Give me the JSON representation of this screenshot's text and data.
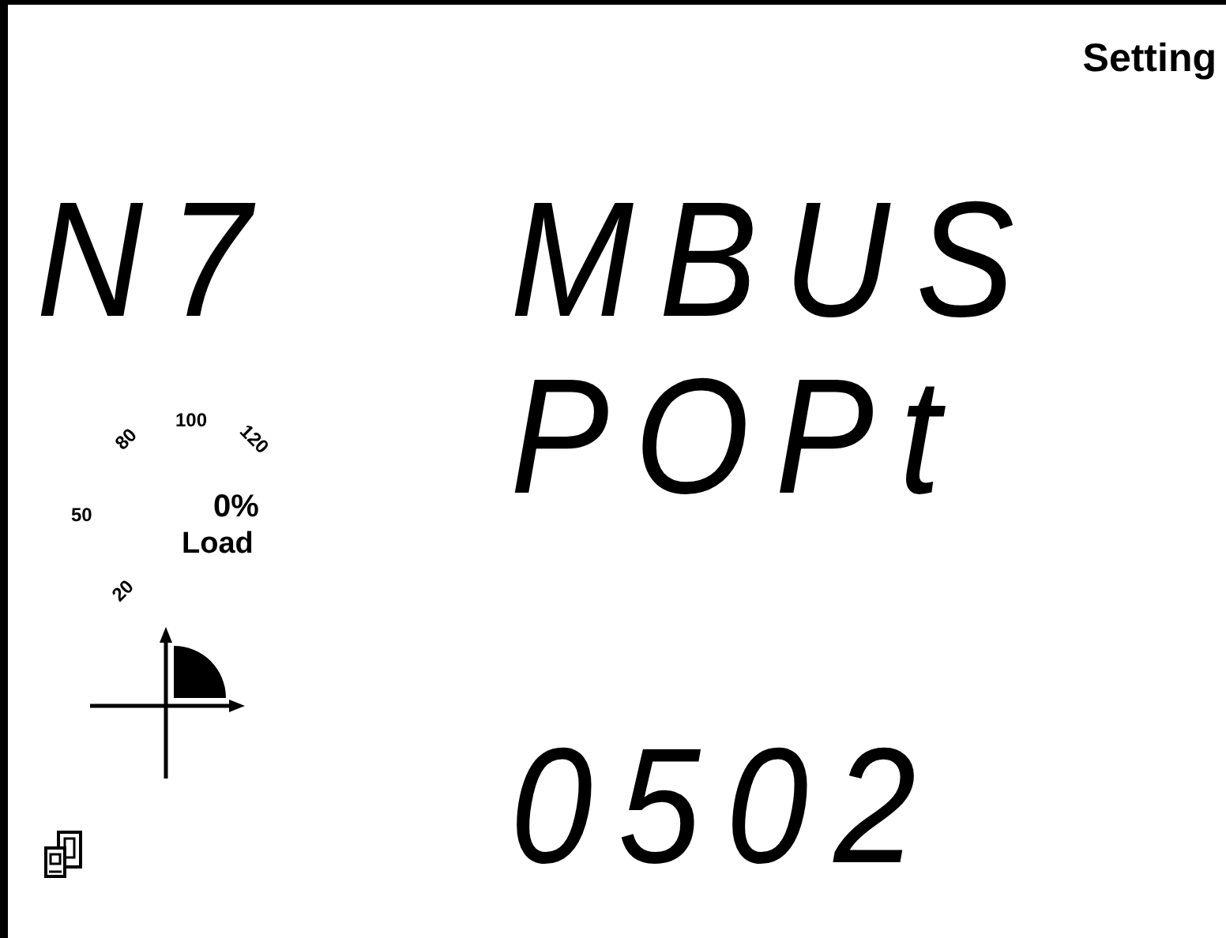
{
  "header": {
    "mode": "Setting"
  },
  "left": {
    "param": "N7",
    "load_gauge": {
      "ticks": [
        "20",
        "50",
        "80",
        "100",
        "120"
      ],
      "value": "0",
      "unit": "%",
      "label": "Load"
    }
  },
  "main": {
    "line1": "MBUS",
    "line2": "POPt",
    "value": "0502"
  }
}
